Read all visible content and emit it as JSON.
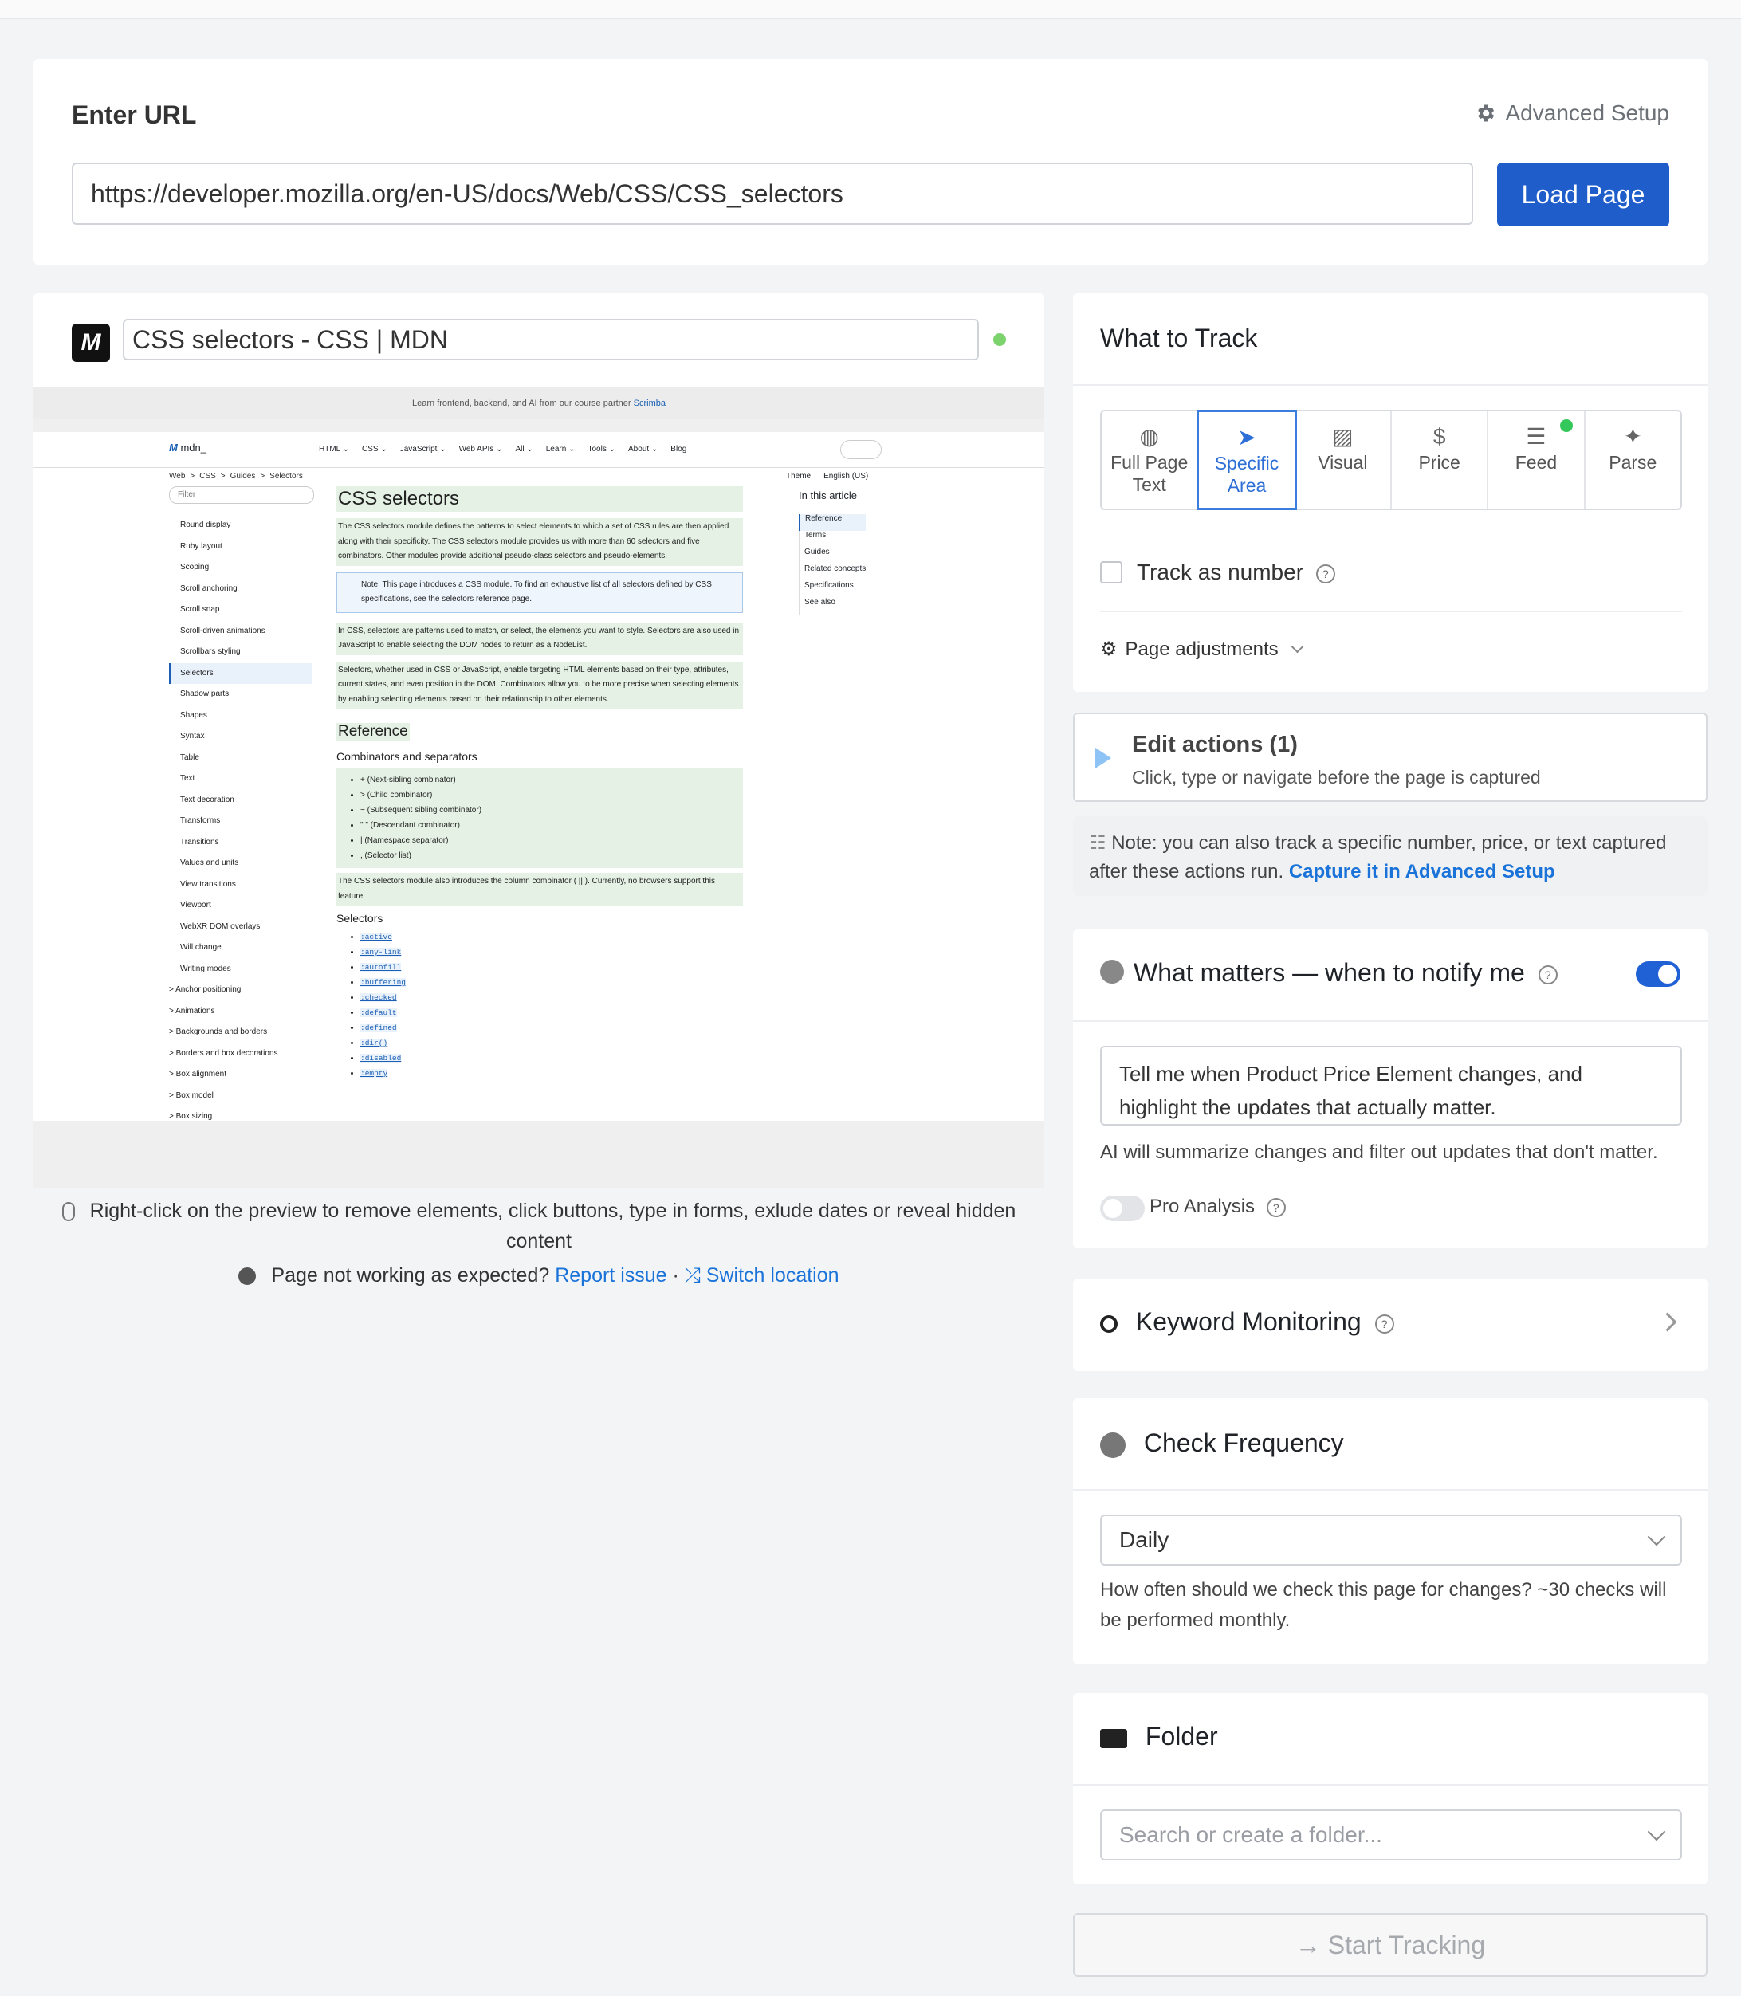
{
  "url_section": {
    "title": "Enter URL",
    "advanced_setup": "Advanced Setup",
    "url_value": "https://developer.mozilla.org/en-US/docs/Web/CSS/CSS_selectors",
    "load_button": "Load Page"
  },
  "preview": {
    "page_title": "CSS selectors - CSS | MDN",
    "site": {
      "banner_text": "Learn frontend, backend, and AI from our course partner",
      "banner_link": "Scrimba",
      "brand": "mdn_",
      "menu": [
        "HTML ⌄",
        "CSS ⌄",
        "JavaScript ⌄",
        "Web APIs ⌄",
        "All ⌄",
        "Learn ⌄",
        "Tools ⌄",
        "About ⌄",
        "Blog"
      ],
      "breadcrumbs": [
        "Web",
        ">",
        "CSS",
        ">",
        "Guides",
        ">",
        "Selectors"
      ],
      "theme": "Theme",
      "language": "English (US)",
      "filter": "Filter",
      "sidebar": [
        "Round display",
        "Ruby layout",
        "Scoping",
        "Scroll anchoring",
        "Scroll snap",
        "Scroll-driven animations",
        "Scrollbars styling",
        "Selectors",
        "Shadow parts",
        "Shapes",
        "Syntax",
        "Table",
        "Text",
        "Text decoration",
        "Transforms",
        "Transitions",
        "Values and units",
        "View transitions",
        "Viewport",
        "WebXR DOM overlays",
        "Will change",
        "Writing modes",
        "> Anchor positioning",
        "> Animations",
        "> Backgrounds and borders",
        "> Borders and box decorations",
        "> Box alignment",
        "> Box model",
        "> Box sizing"
      ],
      "heading": "CSS selectors",
      "intro_1": "The CSS selectors module defines the patterns to select elements to which a set of CSS rules are then applied along with their specificity. The CSS selectors module provides us with more than 60 selectors and five combinators. Other modules provide additional pseudo-class selectors and pseudo-elements.",
      "note": "Note: This page introduces a CSS module. To find an exhaustive list of all selectors defined by CSS specifications, see the selectors reference page.",
      "para_2": "In CSS, selectors are patterns used to match, or select, the elements you want to style. Selectors are also used in JavaScript to enable selecting the DOM nodes to return as a NodeList.",
      "para_3": "Selectors, whether used in CSS or JavaScript, enable targeting HTML elements based on their type, attributes, current states, and even position in the DOM. Combinators allow you to be more precise when selecting elements by enabling selecting elements based on their relationship to other elements.",
      "reference_heading": "Reference",
      "combinators_heading": "Combinators and separators",
      "combinators": [
        "+ (Next-sibling combinator)",
        "> (Child combinator)",
        "~ (Subsequent sibling combinator)",
        "\" \" (Descendant combinator)",
        "| (Namespace separator)",
        ", (Selector list)"
      ],
      "column_note": "The CSS selectors module also introduces the column combinator ( || ). Currently, no browsers support this feature.",
      "selectors_heading": "Selectors",
      "selectors": [
        ":active",
        ":any-link",
        ":autofill",
        ":buffering",
        ":checked",
        ":default",
        ":defined",
        ":dir()",
        ":disabled",
        ":empty"
      ],
      "toc_title": "In this article",
      "toc": [
        "Reference",
        "Terms",
        "Guides",
        "Related concepts",
        "Specifications",
        "See also"
      ]
    },
    "hint": "Right-click on the preview to remove elements, click buttons, type in forms, exlude dates or reveal hidden content",
    "report_prefix": "Page not working as expected?",
    "report_link": "Report issue",
    "separator": "·",
    "switch_link": "Switch location"
  },
  "track": {
    "title": "What to Track",
    "types": [
      {
        "label": "Full Page Text",
        "icon": "globe-icon"
      },
      {
        "label": "Specific Area",
        "icon": "cursor-icon"
      },
      {
        "label": "Visual",
        "icon": "image-icon"
      },
      {
        "label": "Price",
        "icon": "dollar-icon"
      },
      {
        "label": "Feed",
        "icon": "list-icon"
      },
      {
        "label": "Parse",
        "icon": "sparkle-icon"
      }
    ],
    "selected": "Specific Area",
    "track_as_number": "Track as number",
    "page_adjustments": "Page adjustments"
  },
  "edit_actions": {
    "title": "Edit actions (1)",
    "subtitle": "Click, type or navigate before the page is captured"
  },
  "note": {
    "text": "Note: you can also track a specific number, price, or text captured after these actions run.",
    "link": "Capture it in Advanced Setup"
  },
  "matters": {
    "title": "What matters — when to notify me",
    "enabled": true,
    "prompt": "Tell me when Product Price Element changes, and highlight the updates that actually matter.",
    "ai_note": "AI will summarize changes and filter out updates that don't matter.",
    "pro_label": "Pro Analysis",
    "pro_enabled": false
  },
  "keyword": {
    "title": "Keyword Monitoring"
  },
  "frequency": {
    "title": "Check Frequency",
    "value": "Daily",
    "note": "How often should we check this page for changes? ~30 checks will be performed monthly."
  },
  "folder": {
    "title": "Folder",
    "placeholder": "Search or create a folder..."
  },
  "start_button": "Start Tracking",
  "colors": {
    "primary": "#1f5dcb",
    "accent_blue": "#1a73d9",
    "active_type": "#3b7ddd",
    "status_green": "#7cd36d"
  }
}
